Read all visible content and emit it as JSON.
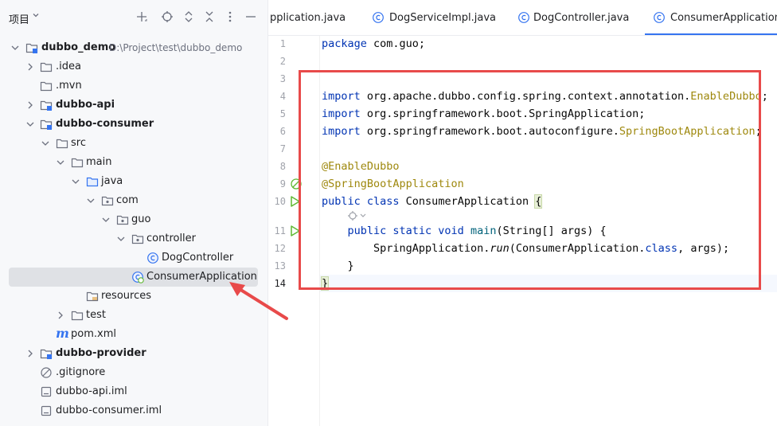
{
  "panel": {
    "title": "项目"
  },
  "tree": [
    {
      "label": "dubbo_demo",
      "path": "D:\\Project\\test\\dubbo_demo",
      "bold": true,
      "expanded": true,
      "icon": "module-folder-icon"
    },
    {
      "label": ".idea",
      "bold": false,
      "icon": "folder-icon"
    },
    {
      "label": ".mvn",
      "bold": false,
      "icon": "folder-icon"
    },
    {
      "label": "dubbo-api",
      "bold": true,
      "icon": "module-folder-icon"
    },
    {
      "label": "dubbo-consumer",
      "bold": true,
      "expanded": true,
      "icon": "module-folder-icon"
    },
    {
      "label": "src",
      "bold": false,
      "expanded": true,
      "icon": "folder-icon"
    },
    {
      "label": "main",
      "bold": false,
      "expanded": true,
      "icon": "folder-icon"
    },
    {
      "label": "java",
      "bold": false,
      "expanded": true,
      "icon": "source-folder-icon"
    },
    {
      "label": "com",
      "bold": false,
      "expanded": true,
      "icon": "package-icon"
    },
    {
      "label": "guo",
      "bold": false,
      "expanded": true,
      "icon": "package-icon"
    },
    {
      "label": "controller",
      "bold": false,
      "expanded": true,
      "icon": "package-icon"
    },
    {
      "label": "DogController",
      "bold": false,
      "icon": "class-icon"
    },
    {
      "label": "ConsumerApplication",
      "bold": false,
      "icon": "spring-class-icon",
      "selected": true
    },
    {
      "label": "resources",
      "bold": false,
      "icon": "resources-folder-icon"
    },
    {
      "label": "test",
      "bold": false,
      "icon": "folder-icon"
    },
    {
      "label": "pom.xml",
      "bold": false,
      "icon": "maven-icon"
    },
    {
      "label": "dubbo-provider",
      "bold": true,
      "icon": "module-folder-icon"
    },
    {
      "label": ".gitignore",
      "bold": false,
      "icon": "ignore-file-icon"
    },
    {
      "label": "dubbo-api.iml",
      "bold": false,
      "icon": "file-icon"
    },
    {
      "label": "dubbo-consumer.iml",
      "bold": false,
      "icon": "file-icon"
    }
  ],
  "tabs": [
    {
      "label": "pplication.java",
      "active": false,
      "icon": ""
    },
    {
      "label": "DogServiceImpl.java",
      "active": false,
      "icon": "class-icon"
    },
    {
      "label": "DogController.java",
      "active": false,
      "icon": "class-icon"
    },
    {
      "label": "ConsumerApplication.ja",
      "active": true,
      "icon": "class-icon"
    }
  ],
  "line_numbers": [
    "1",
    "2",
    "3",
    "4",
    "5",
    "6",
    "7",
    "8",
    "9",
    "10",
    "11",
    "12",
    "13",
    "14"
  ],
  "code": {
    "l1_kw": "package",
    "l1_rest": " com.guo;",
    "l4_kw": "import",
    "l4_pkg": " org.apache.dubbo.config.spring.context.annotation.",
    "l4_cls": "EnableDubbo",
    "l4_end": ";",
    "l5_kw": "import",
    "l5_rest": " org.springframework.boot.SpringApplication;",
    "l6_kw": "import",
    "l6_pkg": " org.springframework.boot.autoconfigure.",
    "l6_cls": "SpringBootApplication",
    "l6_end": ";",
    "l8": "@EnableDubbo",
    "l9": "@SpringBootApplication",
    "l10_kw": "public class",
    "l10_name": " ConsumerApplication ",
    "l10_brace": "{",
    "l11_indent": "    ",
    "l11_kw": "public static void",
    "l11_sp": " ",
    "l11_fn": "main",
    "l11_rest": "(String[] args) {",
    "l12_indent": "        ",
    "l12_a": "SpringApplication.",
    "l12_run": "run",
    "l12_b": "(ConsumerApplication.",
    "l12_cls": "class",
    "l12_c": ", args);",
    "l13": "    }",
    "l14": "}"
  },
  "colors": {
    "annotation_box": "#e84a4a",
    "accent": "#3574f0",
    "selection": "#dfe1e5"
  }
}
